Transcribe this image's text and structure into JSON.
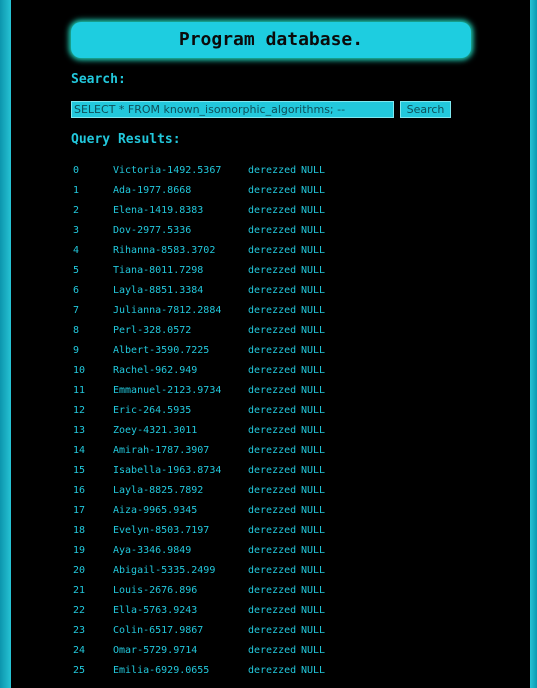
{
  "page": {
    "title": "Program database.",
    "search_label": "Search:",
    "results_label": "Query Results:"
  },
  "search": {
    "value": "SELECT * FROM known_isomorphic_algorithms; --",
    "button_label": "Search"
  },
  "colors": {
    "background": "#000000",
    "accent": "#22c8dc",
    "title_box": "#1ecde0",
    "glow": "#22e0c5"
  },
  "results": [
    {
      "id": "0",
      "name": "Victoria-1492.5367",
      "user": "derezzed",
      "value": "NULL"
    },
    {
      "id": "1",
      "name": "Ada-1977.8668",
      "user": "derezzed",
      "value": "NULL"
    },
    {
      "id": "2",
      "name": "Elena-1419.8383",
      "user": "derezzed",
      "value": "NULL"
    },
    {
      "id": "3",
      "name": "Dov-2977.5336",
      "user": "derezzed",
      "value": "NULL"
    },
    {
      "id": "4",
      "name": "Rihanna-8583.3702",
      "user": "derezzed",
      "value": "NULL"
    },
    {
      "id": "5",
      "name": "Tiana-8011.7298",
      "user": "derezzed",
      "value": "NULL"
    },
    {
      "id": "6",
      "name": "Layla-8851.3384",
      "user": "derezzed",
      "value": "NULL"
    },
    {
      "id": "7",
      "name": "Julianna-7812.2884",
      "user": "derezzed",
      "value": "NULL"
    },
    {
      "id": "8",
      "name": "Perl-328.0572",
      "user": "derezzed",
      "value": "NULL"
    },
    {
      "id": "9",
      "name": "Albert-3590.7225",
      "user": "derezzed",
      "value": "NULL"
    },
    {
      "id": "10",
      "name": "Rachel-962.949",
      "user": "derezzed",
      "value": "NULL"
    },
    {
      "id": "11",
      "name": "Emmanuel-2123.9734",
      "user": "derezzed",
      "value": "NULL"
    },
    {
      "id": "12",
      "name": "Eric-264.5935",
      "user": "derezzed",
      "value": "NULL"
    },
    {
      "id": "13",
      "name": "Zoey-4321.3011",
      "user": "derezzed",
      "value": "NULL"
    },
    {
      "id": "14",
      "name": "Amirah-1787.3907",
      "user": "derezzed",
      "value": "NULL"
    },
    {
      "id": "15",
      "name": "Isabella-1963.8734",
      "user": "derezzed",
      "value": "NULL"
    },
    {
      "id": "16",
      "name": "Layla-8825.7892",
      "user": "derezzed",
      "value": "NULL"
    },
    {
      "id": "17",
      "name": "Aiza-9965.9345",
      "user": "derezzed",
      "value": "NULL"
    },
    {
      "id": "18",
      "name": "Evelyn-8503.7197",
      "user": "derezzed",
      "value": "NULL"
    },
    {
      "id": "19",
      "name": "Aya-3346.9849",
      "user": "derezzed",
      "value": "NULL"
    },
    {
      "id": "20",
      "name": "Abigail-5335.2499",
      "user": "derezzed",
      "value": "NULL"
    },
    {
      "id": "21",
      "name": "Louis-2676.896",
      "user": "derezzed",
      "value": "NULL"
    },
    {
      "id": "22",
      "name": "Ella-5763.9243",
      "user": "derezzed",
      "value": "NULL"
    },
    {
      "id": "23",
      "name": "Colin-6517.9867",
      "user": "derezzed",
      "value": "NULL"
    },
    {
      "id": "24",
      "name": "Omar-5729.9714",
      "user": "derezzed",
      "value": "NULL"
    },
    {
      "id": "25",
      "name": "Emilia-6929.0655",
      "user": "derezzed",
      "value": "NULL"
    }
  ]
}
